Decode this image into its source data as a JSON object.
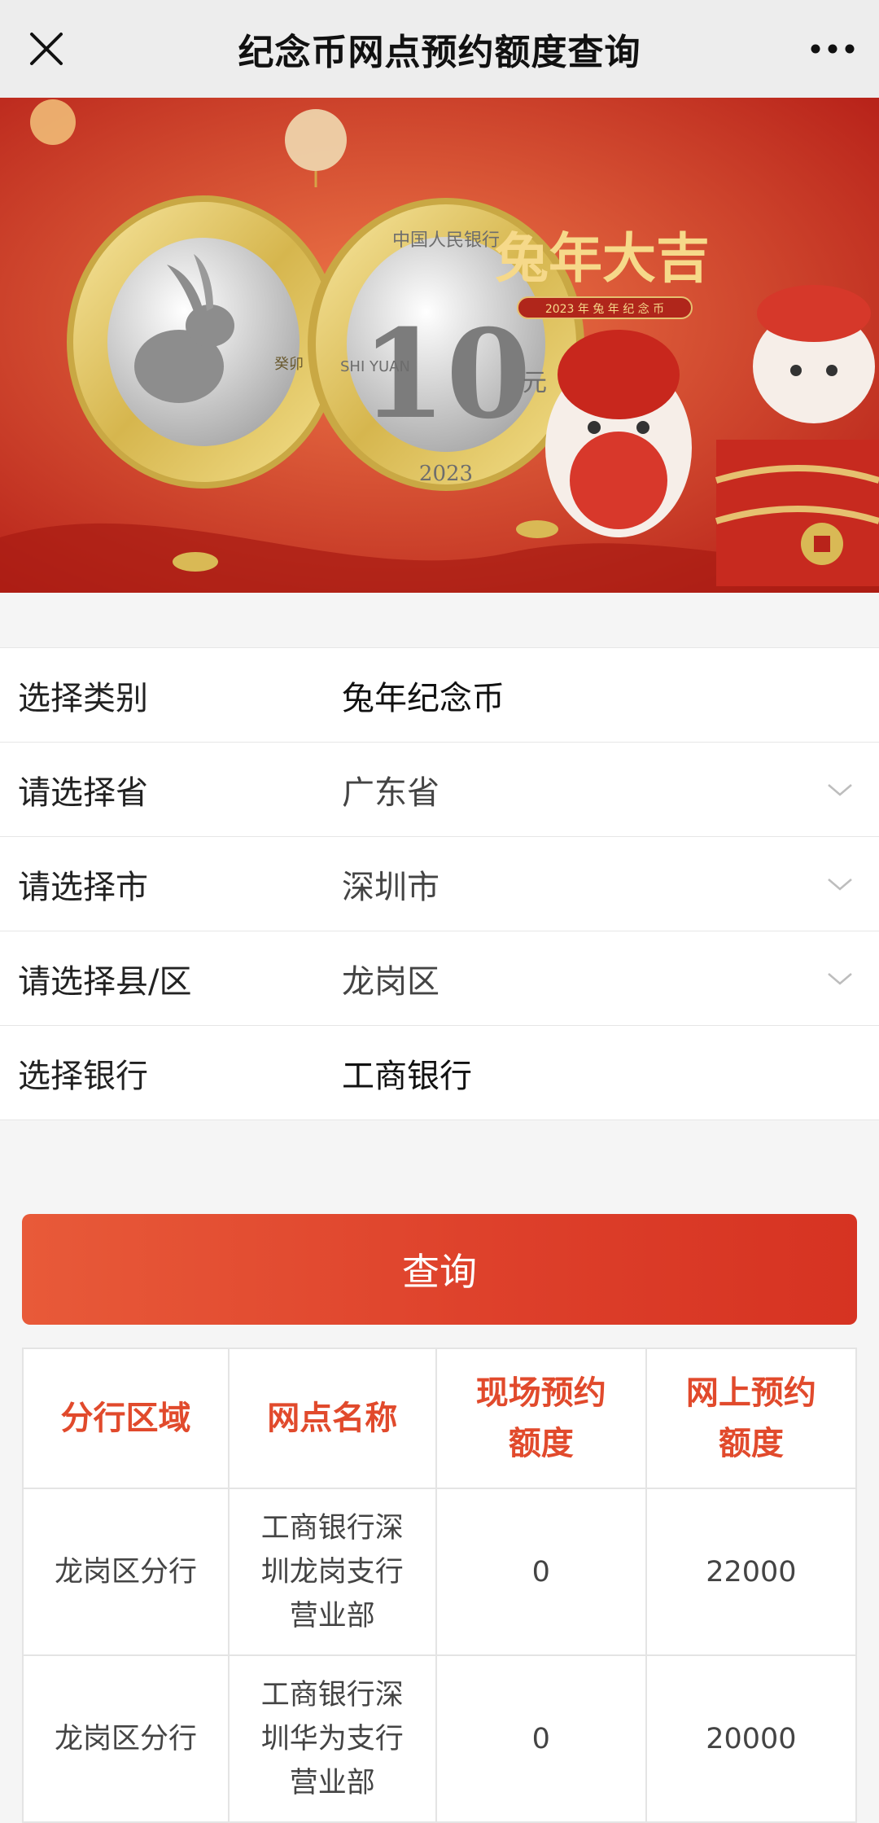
{
  "header": {
    "title": "纪念币网点预约额度查询"
  },
  "banner": {
    "headline": "兔年大吉",
    "sub": "2023 年 兔 年 纪 念 币",
    "coin_value": "10",
    "coin_unit": "元",
    "coin_top_text": "中国人民银行",
    "coin_left_text": "SHI YUAN",
    "coin_year": "2023",
    "zodiac_text": "癸卯"
  },
  "form": {
    "rows": [
      {
        "label": "选择类别",
        "value": "兔年纪念币"
      },
      {
        "label": "请选择省",
        "value": "广东省"
      },
      {
        "label": "请选择市",
        "value": "深圳市"
      },
      {
        "label": "请选择县/区",
        "value": "龙岗区"
      },
      {
        "label": "选择银行",
        "value": "工商银行"
      }
    ]
  },
  "query_button": "查询",
  "table": {
    "headers": [
      "分行区域",
      "网点名称",
      "现场预约额度",
      "网上预约额度"
    ],
    "rows": [
      [
        "龙岗区分行",
        "工商银行深圳龙岗支行营业部",
        "0",
        "22000"
      ],
      [
        "龙岗区分行",
        "工商银行深圳华为支行营业部",
        "0",
        "20000"
      ]
    ]
  },
  "colors": {
    "accent": "#e14a2c",
    "button": "#dd3f2a"
  }
}
